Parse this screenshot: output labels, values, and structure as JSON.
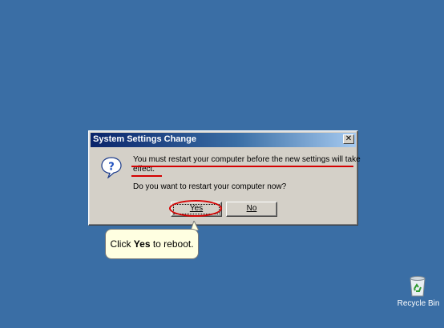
{
  "dialog": {
    "title": "System Settings Change",
    "close_glyph": "✕",
    "icon": "question-icon",
    "message_line1": "You must restart your computer before the new settings will take",
    "message_line2": "effect.",
    "question": "Do you want to restart your computer now?",
    "yes_label": "Yes",
    "no_label": "No"
  },
  "callout": {
    "prefix": "Click ",
    "bold": "Yes",
    "suffix": " to reboot."
  },
  "desktop": {
    "recycle_bin_label": "Recycle Bin"
  },
  "colors": {
    "desktop": "#3a6ea5",
    "titlebar_start": "#0a246a",
    "titlebar_end": "#a6caf0",
    "dialog_face": "#d4d0c8",
    "annotation": "#d40000",
    "callout_bg": "#ffffe1"
  }
}
